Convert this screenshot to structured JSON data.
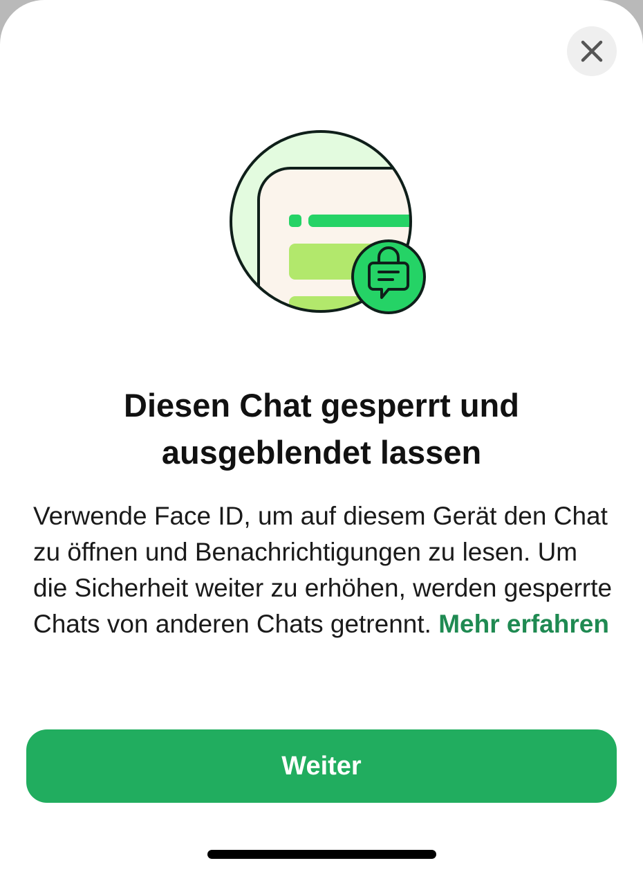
{
  "dialog": {
    "title": "Diesen Chat gesperrt und ausgeblendet lassen",
    "body": "Verwende Face ID, um auf diesem Gerät den Chat zu öffnen und Benachrichtigungen zu lesen. Um die Sicherheit weiter zu erhöhen, werden gesperrte Chats von anderen Chats getrennt.",
    "learn_more": "Mehr erfahren",
    "continue_label": "Weiter",
    "close_icon": "close-icon",
    "illustration_icon": "locked-chat-icon"
  },
  "colors": {
    "accent": "#21ad5f",
    "link": "#1f8a52",
    "illustration_green": "#25d366",
    "illustration_light_green": "#e3fbdf",
    "illustration_lime": "#b2e86c",
    "illustration_cream": "#fbf4ec"
  }
}
